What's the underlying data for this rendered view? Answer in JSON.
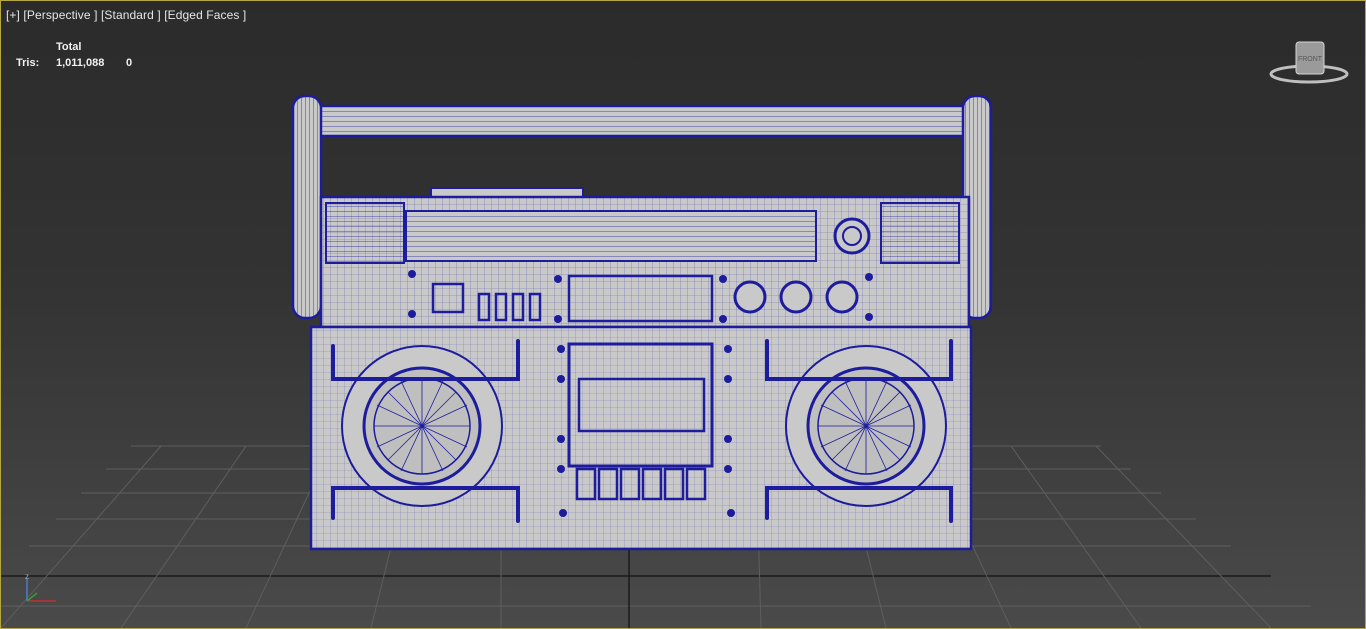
{
  "viewport": {
    "labels": {
      "plus": "[+]",
      "view": "[Perspective ]",
      "shading": "[Standard ]",
      "mode": "[Edged Faces ]"
    },
    "stats": {
      "header": "Total",
      "tris_label": "Tris:",
      "tris_total": "1,011,088",
      "tris_selected": "0"
    },
    "viewcube_label": "FRONT",
    "axis_label": "z"
  },
  "colors": {
    "background_top": "#2b2b2b",
    "background_bottom": "#4a4a4a",
    "grid": "#5e5e5e",
    "wireframe": "#1c1c9c",
    "model_fill": "#c9c9c9",
    "viewport_border": "#b8a640"
  }
}
